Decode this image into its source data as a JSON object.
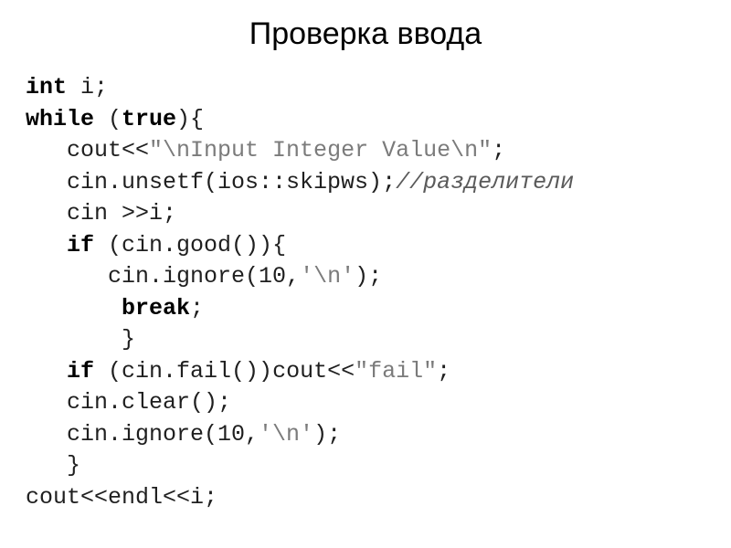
{
  "title": "Проверка ввода",
  "code": {
    "l01": {
      "kw_int": "int",
      "rest": " i;"
    },
    "l02": {
      "kw_while": "while",
      "rest1": " (",
      "kw_true": "true",
      "rest2": "){"
    },
    "l03": {
      "pre": "   cout<<",
      "str": "\"\\nInput Integer Value\\n\"",
      "post": ";"
    },
    "l04": {
      "pre": "   cin.unsetf(ios::skipws);",
      "cm": "//разделители"
    },
    "l05": {
      "txt": "   cin >>i;"
    },
    "l06": {
      "pre": "   ",
      "kw_if": "if",
      "rest": " (cin.good()){"
    },
    "l07": {
      "pre": "      cin.ignore(10,",
      "ch": "'\\n'",
      "post": ");"
    },
    "l08": {
      "pre": "       ",
      "kw_break": "break",
      "post": ";"
    },
    "l09": {
      "txt": "       }"
    },
    "l10": {
      "pre": "   ",
      "kw_if": "if",
      "mid": " (cin.fail())cout<<",
      "str": "\"fail\"",
      "post": ";"
    },
    "l11": {
      "txt": "   cin.clear();"
    },
    "l12": {
      "pre": "   cin.ignore(10,",
      "ch": "'\\n'",
      "post": ");"
    },
    "l13": {
      "txt": "   }"
    },
    "l14": {
      "txt": "cout<<endl<<i;"
    }
  }
}
